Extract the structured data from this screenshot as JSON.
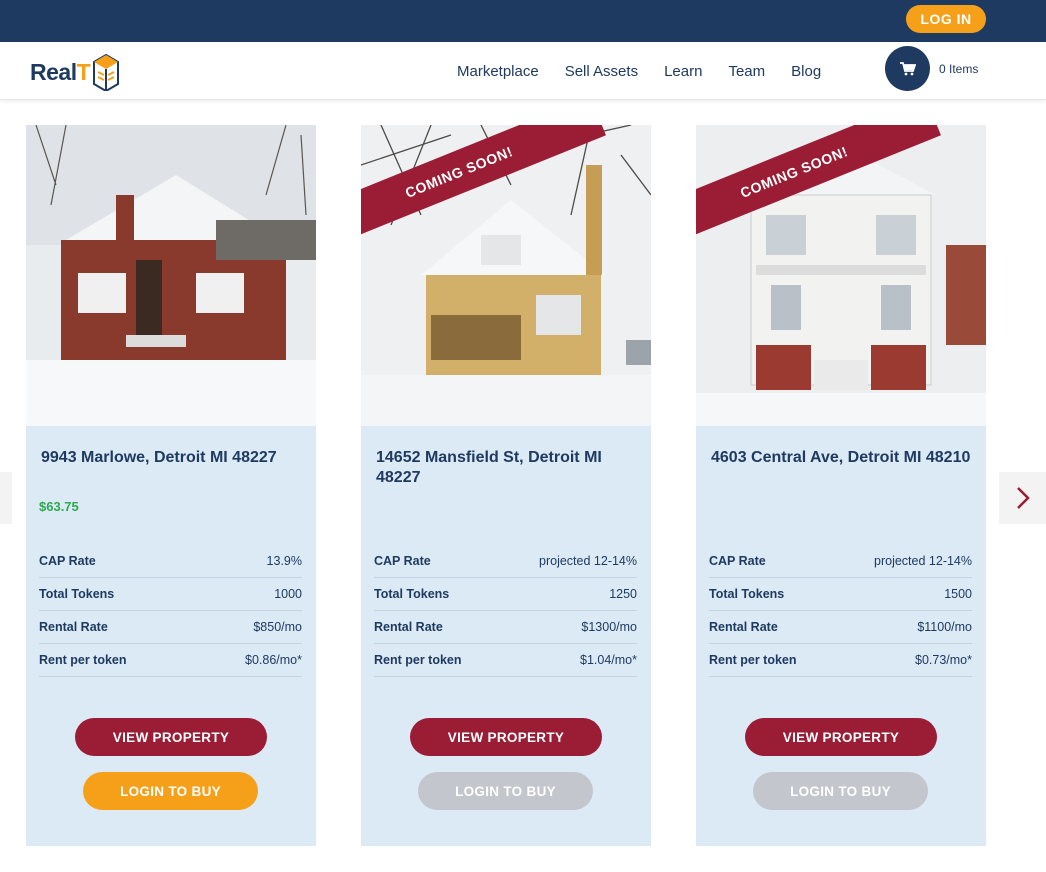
{
  "header": {
    "login_label": "LOG IN",
    "logo": {
      "text_a": "Real",
      "text_b": "T"
    },
    "nav": [
      "Marketplace",
      "Sell Assets",
      "Learn",
      "Team",
      "Blog"
    ],
    "cart_label": "0 Items"
  },
  "colors": {
    "navy": "#1f3a60",
    "orange": "#f6a01a",
    "maroon": "#9a1c35",
    "green": "#2fa84f",
    "card_bg": "#dceaf6",
    "disabled": "#c3c6cc"
  },
  "cards": [
    {
      "title": "9943 Marlowe, Detroit MI 48227",
      "price": "$63.75",
      "ribbon": "",
      "stats": [
        {
          "label": "CAP Rate",
          "value": "13.9%"
        },
        {
          "label": "Total Tokens",
          "value": "1000"
        },
        {
          "label": "Rental Rate",
          "value": "$850/mo"
        },
        {
          "label": "Rent per token",
          "value": "$0.86/mo*"
        }
      ],
      "view_label": "VIEW PROPERTY",
      "buy_label": "LOGIN TO BUY",
      "buy_enabled": true
    },
    {
      "title": "14652 Mansfield St, Detroit MI 48227",
      "price": "",
      "ribbon": "COMING SOON!",
      "stats": [
        {
          "label": "CAP Rate",
          "value": "projected 12-14%"
        },
        {
          "label": "Total Tokens",
          "value": "1250"
        },
        {
          "label": "Rental Rate",
          "value": "$1300/mo"
        },
        {
          "label": "Rent per token",
          "value": "$1.04/mo*"
        }
      ],
      "view_label": "VIEW PROPERTY",
      "buy_label": "LOGIN TO BUY",
      "buy_enabled": false
    },
    {
      "title": "4603 Central Ave, Detroit MI 48210",
      "price": "",
      "ribbon": "COMING SOON!",
      "stats": [
        {
          "label": "CAP Rate",
          "value": "projected 12-14%"
        },
        {
          "label": "Total Tokens",
          "value": "1500"
        },
        {
          "label": "Rental Rate",
          "value": "$1100/mo"
        },
        {
          "label": "Rent per token",
          "value": "$0.73/mo*"
        }
      ],
      "view_label": "VIEW PROPERTY",
      "buy_label": "LOGIN TO BUY",
      "buy_enabled": false
    }
  ]
}
